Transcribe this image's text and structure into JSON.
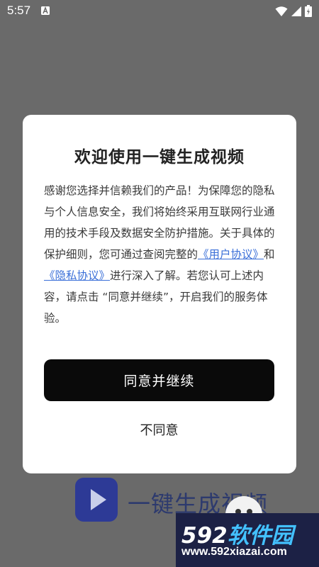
{
  "status_bar": {
    "time": "5:57"
  },
  "background": {
    "app_title": "一键生成视频",
    "logo_color": "#2d3a96"
  },
  "dialog": {
    "title": "欢迎使用一键生成视频",
    "body_text_1": "感谢您选择并信赖我们的产品！为保障您的隐私与个人信息安全，我们将始终采用互联网行业通用的技术手段及数据安全防护措施。关于具体的保护细则，您可通过查阅完整的",
    "user_agreement_link": "《用户协议》",
    "body_and": "和",
    "privacy_agreement_link": "《隐私协议》",
    "body_text_2": "进行深入了解。若您认可上述内容，请点击 “同意并继续”，开启我们的服务体验。",
    "agree_label": "同意并继续",
    "disagree_label": "不同意"
  },
  "watermark": {
    "brand_number": "592",
    "brand_text": "软件园",
    "url": "www.592xiazai.com"
  },
  "colors": {
    "overlay": "#6a6a6a",
    "accent_link": "#3a6fd8",
    "primary_button": "#0a0a0a"
  }
}
